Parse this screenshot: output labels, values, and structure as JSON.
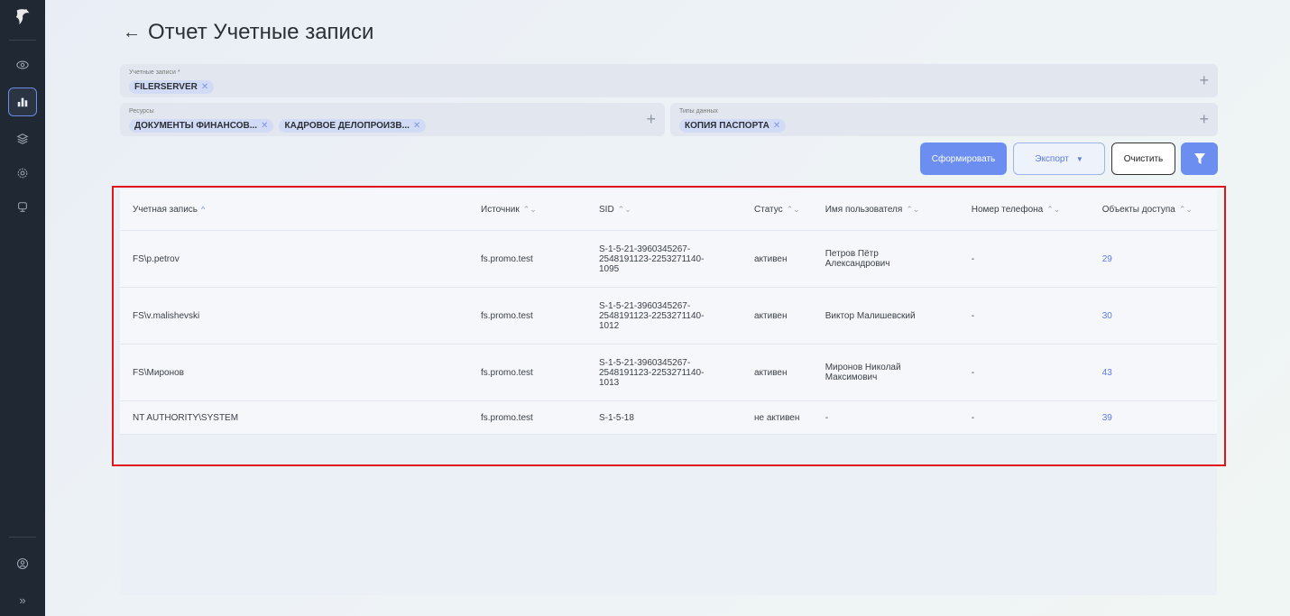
{
  "page": {
    "title": "Отчет Учетные записи",
    "back_arrow": "←"
  },
  "filters": {
    "accounts": {
      "label": "Учетные записи *",
      "chips": [
        "FILERSERVER"
      ]
    },
    "resources": {
      "label": "Ресурсы",
      "chips": [
        "ДОКУМЕНТЫ ФИНАНСОВ...",
        "КАДРОВОЕ ДЕЛОПРОИЗВ..."
      ]
    },
    "data_types": {
      "label": "Типы данных",
      "chips": [
        "КОПИЯ ПАСПОРТА"
      ]
    },
    "chip_remove": "✕",
    "add": "+"
  },
  "actions": {
    "generate": "Сформировать",
    "export": "Экспорт",
    "clear": "Очистить"
  },
  "table": {
    "columns": [
      "Учетная запись",
      "Источник",
      "SID",
      "Статус",
      "Имя пользователя",
      "Номер телефона",
      "Объекты доступа"
    ],
    "sort_asc": "^",
    "sort_both": "⌃⌄",
    "rows": [
      {
        "account": "FS\\p.petrov",
        "source": "fs.promo.test",
        "sid": [
          "S-1-5-21-3960345267-",
          "2548191123-2253271140-",
          "1095"
        ],
        "status": "активен",
        "username": [
          "Петров Пётр",
          "Александрович"
        ],
        "phone": "-",
        "objects": "29"
      },
      {
        "account": "FS\\v.malishevski",
        "source": "fs.promo.test",
        "sid": [
          "S-1-5-21-3960345267-",
          "2548191123-2253271140-",
          "1012"
        ],
        "status": "активен",
        "username": [
          "Виктор Малишевский"
        ],
        "phone": "-",
        "objects": "30"
      },
      {
        "account": "FS\\Миронов",
        "source": "fs.promo.test",
        "sid": [
          "S-1-5-21-3960345267-",
          "2548191123-2253271140-",
          "1013"
        ],
        "status": "активен",
        "username": [
          "Миронов Николай",
          "Максимович"
        ],
        "phone": "-",
        "objects": "43"
      },
      {
        "account": "NT AUTHORITY\\SYSTEM",
        "source": "fs.promo.test",
        "sid": [
          "S-1-5-18"
        ],
        "status": "не активен",
        "username": [
          "-"
        ],
        "phone": "-",
        "objects": "39"
      }
    ]
  },
  "colors": {
    "accent": "#6b8ef0",
    "sidebar": "#202833",
    "highlight": "#e0141a"
  },
  "sidebar_icons": [
    "eye-icon",
    "chart-icon",
    "database-icon",
    "gear-icon",
    "monitor-icon",
    "user-icon",
    "chevron-double-right-icon"
  ]
}
